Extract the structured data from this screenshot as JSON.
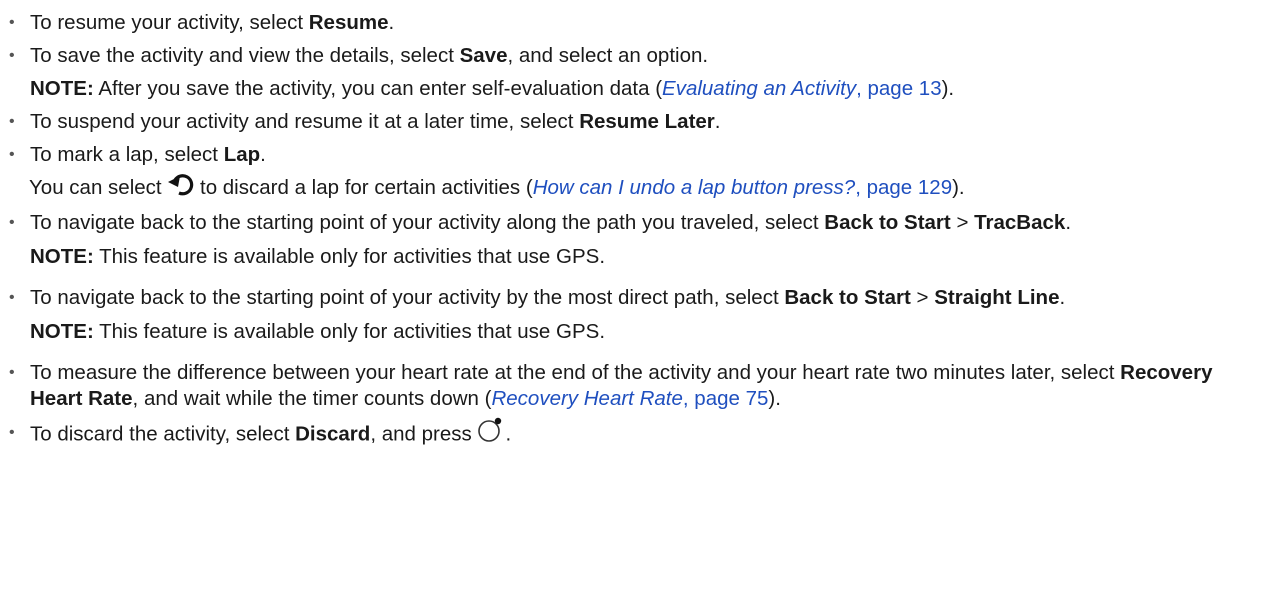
{
  "items": [
    {
      "pre": "To resume your activity, select ",
      "bold": "Resume",
      "post": "."
    },
    {
      "pre": "To save the activity and view the details, select ",
      "bold": "Save",
      "post": ", and select an option.",
      "note_label": "NOTE:",
      "note_text": " After you save the activity, you can enter self-evaluation data (",
      "note_link": "Evaluating an Activity",
      "note_page": ", page 13",
      "note_end": ")."
    },
    {
      "pre": "To suspend your activity and resume it at a later time, select ",
      "bold": "Resume Later",
      "post": "."
    },
    {
      "pre": "To mark a lap, select ",
      "bold": "Lap",
      "post": ".",
      "sub_pre": "You can select ",
      "sub_mid": " to discard a lap for certain activities (",
      "sub_link": "How can I undo a lap button press?",
      "sub_page": ", page 129",
      "sub_end": ")."
    },
    {
      "pre": "To navigate back to the starting point of your activity along the path you traveled, select ",
      "bold1": "Back to Start",
      "mid": " > ",
      "bold2": "TracBack",
      "post": ".",
      "note_label": "NOTE:",
      "note_text": " This feature is available only for activities that use GPS."
    },
    {
      "pre": "To navigate back to the starting point of your activity by the most direct path, select ",
      "bold1": "Back to Start",
      "mid": " > ",
      "bold2": "Straight Line",
      "post": ".",
      "note_label": "NOTE:",
      "note_text": " This feature is available only for activities that use GPS."
    },
    {
      "pre": "To measure the difference between your heart rate at the end of the activity and your heart rate two minutes later, select ",
      "bold": "Recovery Heart Rate",
      "mid": ", and wait while the timer counts down (",
      "link": "Recovery Heart Rate",
      "page_sep": ",",
      "page": "page 75",
      "post": ")."
    },
    {
      "pre": "To discard the activity, select ",
      "bold": "Discard",
      "mid": ", and press ",
      "post": "."
    }
  ],
  "icons": {
    "undo": "undo-arrow-icon",
    "watch_button": "watch-button-icon"
  },
  "colors": {
    "text": "#1a1a1a",
    "link": "#1f4fbf"
  }
}
